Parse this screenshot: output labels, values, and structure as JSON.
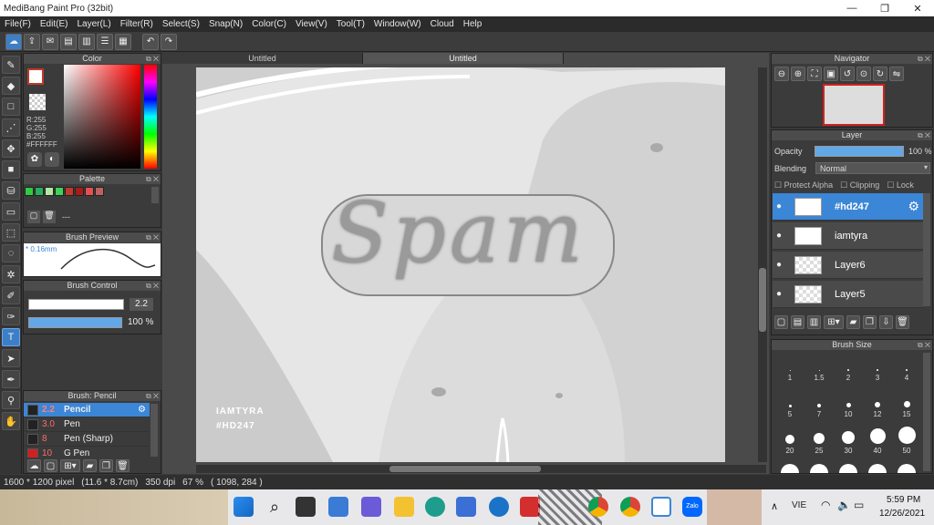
{
  "window": {
    "title": "MediBang Paint Pro (32bit)",
    "min": "—",
    "max": "❐",
    "close": "✕"
  },
  "menu": [
    "File(F)",
    "Edit(E)",
    "Layer(L)",
    "Filter(R)",
    "Select(S)",
    "Snap(N)",
    "Color(C)",
    "View(V)",
    "Tool(T)",
    "Window(W)",
    "Cloud",
    "Help"
  ],
  "panels": {
    "color": {
      "title": "Color",
      "r": "R:255",
      "g": "G:255",
      "b": "B:255",
      "hex": "#FFFFFF"
    },
    "palette": {
      "title": "Palette",
      "more": "---",
      "swatches": [
        "#2ecc40",
        "#27ae60",
        "#b6e6a0",
        "#3dd35a",
        "#c0392b",
        "#a61c1c",
        "#e55050",
        "#c06060"
      ]
    },
    "brush_preview": {
      "title": "Brush Preview",
      "size": "* 0.16mm"
    },
    "brush_control": {
      "title": "Brush Control",
      "size_value": "2.2",
      "opacity_value": "100 %",
      "size_fraction": 1.0,
      "opacity_fraction": 1.0
    },
    "brush_list": {
      "title": "Brush: Pencil",
      "items": [
        {
          "size": "2.2",
          "name": "Pencil",
          "selected": true,
          "color": "#222222"
        },
        {
          "size": "3.0",
          "name": "Pen",
          "selected": false,
          "color": "#222222"
        },
        {
          "size": "8",
          "name": "Pen (Sharp)",
          "selected": false,
          "color": "#222222"
        },
        {
          "size": "10",
          "name": "G Pen",
          "selected": false,
          "color": "#d02020"
        }
      ]
    },
    "navigator": {
      "title": "Navigator"
    },
    "layer": {
      "title": "Layer",
      "opacity_label": "Opacity",
      "opacity_value": "100 %",
      "blending_label": "Blending",
      "blending_value": "Normal",
      "protect_alpha": "Protect Alpha",
      "clipping": "Clipping",
      "lock": "Lock",
      "layers": [
        {
          "name": "#hd247",
          "selected": true,
          "thumb": "white"
        },
        {
          "name": "iamtyra",
          "selected": false,
          "thumb": "white"
        },
        {
          "name": "Layer6",
          "selected": false,
          "thumb": "checker"
        },
        {
          "name": "Layer5",
          "selected": false,
          "thumb": "checker"
        }
      ]
    },
    "brush_size": {
      "title": "Brush Size",
      "sizes": [
        "1",
        "1.5",
        "2",
        "3",
        "4",
        "5",
        "7",
        "10",
        "12",
        "15",
        "20",
        "25",
        "30",
        "40",
        "50"
      ]
    }
  },
  "tabs": [
    "Untitled",
    "Untitled"
  ],
  "canvas": {
    "text_main": "Spam",
    "text_credit1": "IAMTYRA",
    "text_credit2": "#HD247"
  },
  "status": {
    "size": "1600 * 1200 pixel",
    "mm": "(11.6 * 8.7cm)",
    "dpi": "350 dpi",
    "zoom": "67 %",
    "coords": "( 1098, 284 )"
  },
  "taskbar": {
    "lang": "VIE",
    "time": "5:59 PM",
    "date": "12/26/2021",
    "tray_up": "∧"
  }
}
